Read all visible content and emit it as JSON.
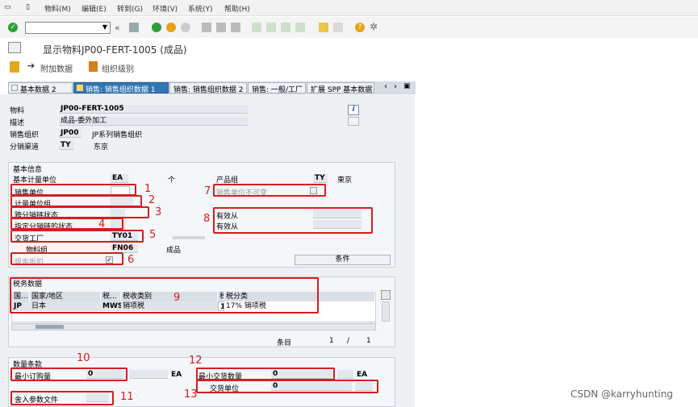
{
  "menu": [
    "物料(M)",
    "编辑(E)",
    "转到(G)",
    "环境(V)",
    "系统(Y)",
    "帮助(H)"
  ],
  "title": "显示物料JP00-FERT-1005 (成品)",
  "app_toolbar": {
    "extra_data": "附加数据",
    "org_levels": "组织级别"
  },
  "tabs": [
    "基本数据 2",
    "销售: 销售组织数据 1",
    "销售: 销售组织数据 2",
    "销售: 一般/工厂",
    "扩展 SPP 基本数据"
  ],
  "header": {
    "material_label": "物料",
    "material_value": "JP00-FERT-1005",
    "desc_label": "描述",
    "desc_value": "成品-委外加工",
    "salesorg_label": "销售组织",
    "salesorg_code": "JP00",
    "salesorg_text": "JP系列销售组织",
    "channel_label": "分销渠道",
    "channel_code": "TY",
    "channel_text": "东京"
  },
  "basic": {
    "title": "基本信息",
    "base_uom_label": "基本计量单位",
    "base_uom_value": "EA",
    "base_uom_text": "个",
    "sales_unit_label": "销售单位",
    "uom_group_label": "计量单位组",
    "xchain_label": "跨分销链状态",
    "dchain_label": "指定分销链的状态",
    "plant_label": "交货工厂",
    "plant_value": "TY01",
    "matgroup_label": "物料组",
    "matgroup_value": "FN06",
    "matgroup_text": "成品",
    "cash_discount_label": "现金折扣",
    "cash_discount_checked": "✓",
    "prodhier_label": "产品组",
    "prodhier_value": "TY",
    "prodhier_text": "東京",
    "sales_unit_fixed_label": "销售单位不可变",
    "valid_from1": "有效从",
    "valid_from2": "有效从",
    "conditions_btn": "条件"
  },
  "tax": {
    "title": "税务数据",
    "cols": [
      "国...",
      "国家/地区",
      "税...",
      "税收类别",
      "税",
      "税分类"
    ],
    "row": [
      "JP",
      "日本",
      "MWST",
      "销项税",
      "1",
      "17% 销项税"
    ],
    "entry_label": "条目",
    "entry_cur": "1",
    "entry_sep": "/",
    "entry_total": "1"
  },
  "qty": {
    "title": "数量条款",
    "min_order_label": "最小订购量",
    "min_order_value": "0",
    "min_order_unit": "EA",
    "min_deliv_label": "最小交货数量",
    "min_deliv_value": "0",
    "min_deliv_unit": "EA",
    "rounding_label": "舍入参数文件",
    "deliv_unit_label": "交货单位",
    "deliv_unit_value": "0"
  },
  "annotations": [
    "1",
    "2",
    "3",
    "4",
    "5",
    "6",
    "7",
    "8",
    "9",
    "10",
    "11",
    "12",
    "13"
  ],
  "watermark": "CSDN @karryhunting"
}
